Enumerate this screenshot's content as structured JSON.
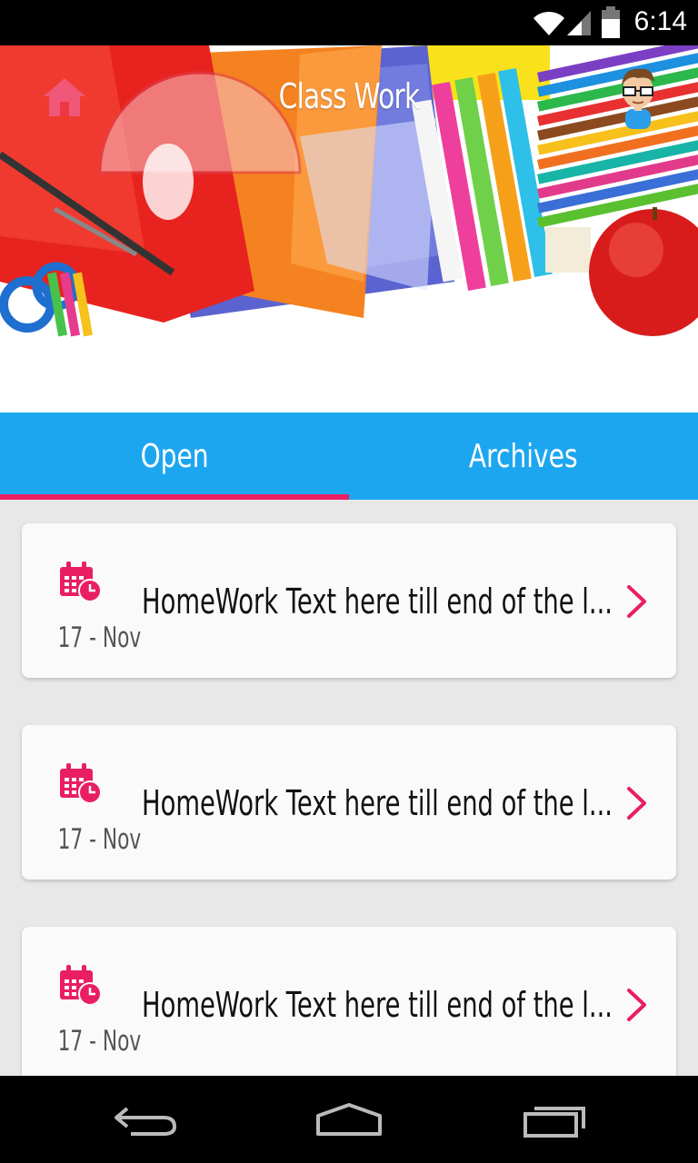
{
  "status_bar": {
    "time": "6:14"
  },
  "header": {
    "title": "Class Work"
  },
  "tabs": [
    {
      "label": "Open",
      "active": true
    },
    {
      "label": "Archives",
      "active": false
    }
  ],
  "items": [
    {
      "date": "17 - Nov",
      "title": "HomeWork Text here till end of the l..."
    },
    {
      "date": "17 - Nov",
      "title": "HomeWork Text here till end of the l..."
    },
    {
      "date": "17 - Nov",
      "title": "HomeWork Text here till end of the l..."
    }
  ],
  "colors": {
    "accent": "#e91e63",
    "tab_bar": "#1da6f0",
    "list_bg": "#e8e8e8"
  },
  "icons": [
    "wifi-icon",
    "signal-icon",
    "battery-icon",
    "home-icon",
    "avatar",
    "calendar-icon",
    "chevron-right-icon",
    "back-icon",
    "home-nav-icon",
    "recents-icon"
  ]
}
